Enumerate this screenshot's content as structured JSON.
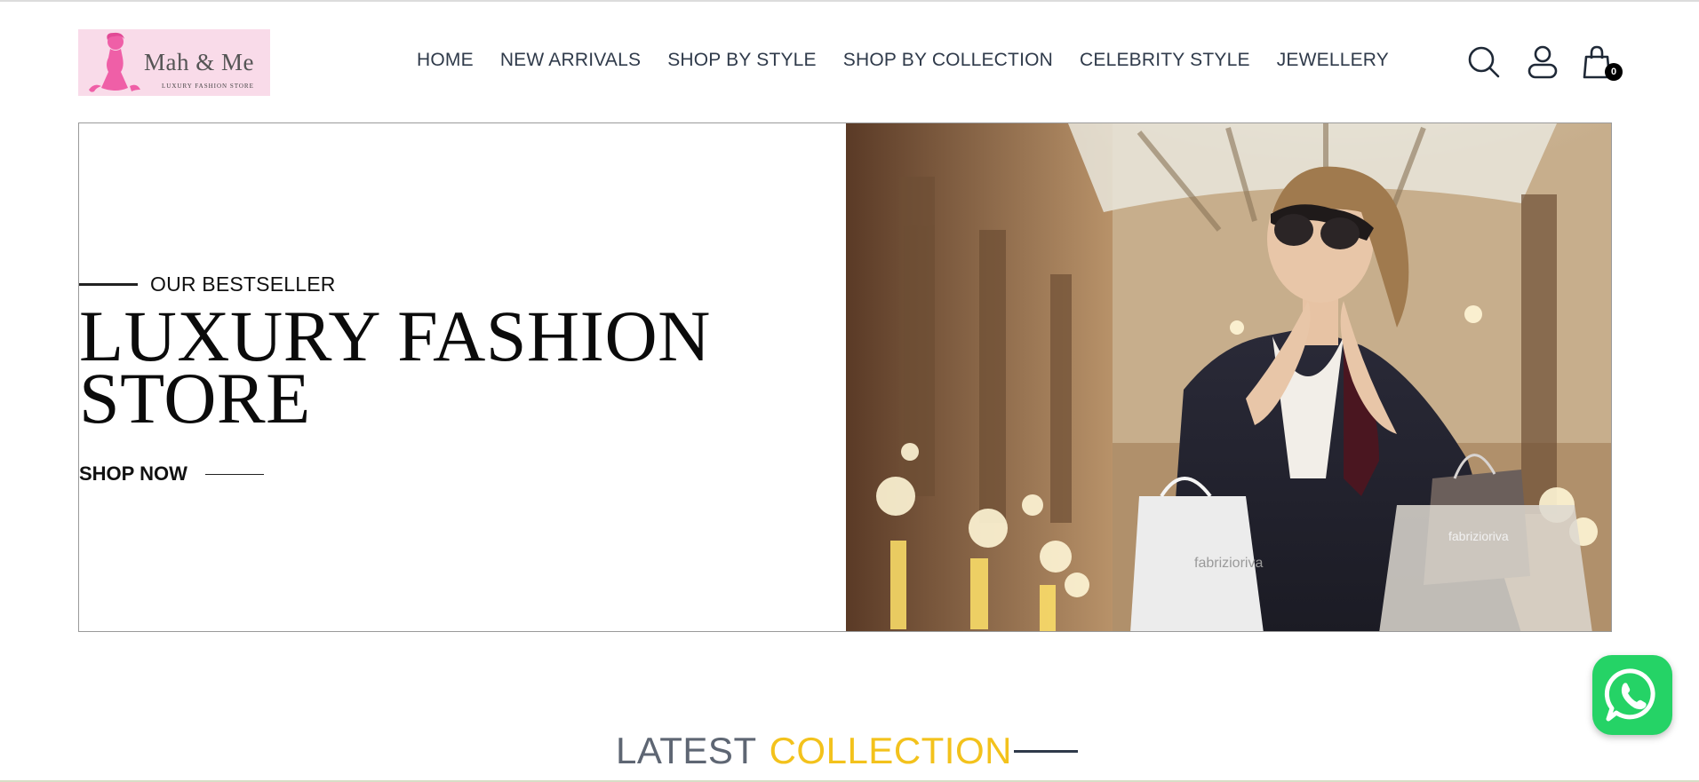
{
  "brand": {
    "name": "Mah & Me",
    "tagline": "LUXURY FASHION STORE",
    "colors": {
      "logo_bg": "#f9dbe9",
      "logo_figure": "#ef5fa7"
    }
  },
  "nav": {
    "items": [
      {
        "label": "HOME"
      },
      {
        "label": "NEW ARRIVALS"
      },
      {
        "label": "SHOP BY STYLE"
      },
      {
        "label": "SHOP BY COLLECTION"
      },
      {
        "label": "CELEBRITY STYLE"
      },
      {
        "label": "JEWELLERY"
      }
    ]
  },
  "header_icons": {
    "search": "search-icon",
    "account": "user-icon",
    "cart": "shopping-bag-icon",
    "cart_count": "0"
  },
  "hero": {
    "eyebrow": "OUR BESTSELLER",
    "title": "LUXURY FASHION STORE",
    "cta": "SHOP NOW",
    "image_alt": "Woman in sunglasses holding shopping bags in a galleria",
    "bag_text": "fabrizioriva"
  },
  "collection": {
    "heading_part1": "LATEST",
    "heading_part2": "COLLECTION",
    "colors": {
      "part1": "#5e6673",
      "part2": "#f3c21c"
    }
  },
  "floating": {
    "whatsapp": "whatsapp-icon",
    "color": "#25d366"
  }
}
